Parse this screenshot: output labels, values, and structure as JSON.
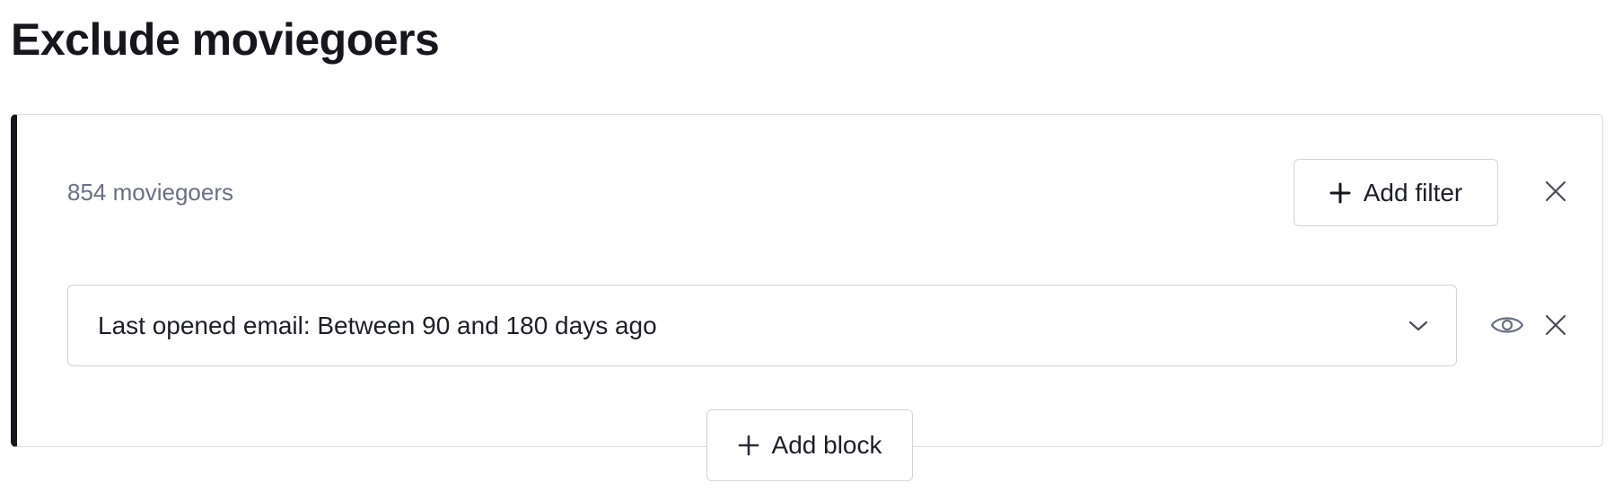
{
  "page": {
    "title": "Exclude moviegoers"
  },
  "block": {
    "count_label": "854 moviegoers",
    "add_filter_label": "Add filter",
    "filters": [
      {
        "label": "Last opened email: Between 90 and 180 days ago"
      }
    ]
  },
  "footer": {
    "add_block_label": "Add block"
  },
  "icons": {
    "plus": "plus-icon",
    "close": "close-icon",
    "chevron": "chevron-down-icon",
    "eye": "eye-icon"
  },
  "colors": {
    "accent_bar": "#16171d",
    "muted_text": "#6b7080",
    "border": "#d2d4d9"
  }
}
